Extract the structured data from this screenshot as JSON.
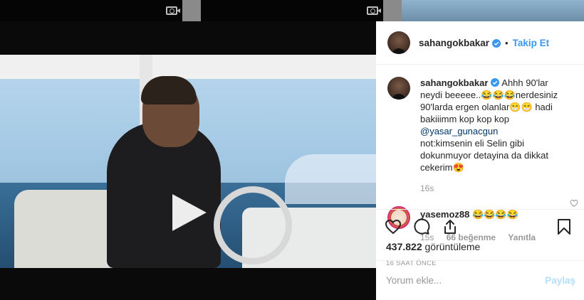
{
  "post": {
    "username": "sahangokbakar",
    "follow_label": "Takip Et",
    "caption_user": "sahangokbakar",
    "caption_text": "Ahhh 90'lar neydi beeeee..😂😂😂nerdesiniz 90'larda ergen olanlar😁😁 hadi bakiiimm kop kop kop",
    "caption_mention": "@yasar_gunacgun",
    "caption_note": "not:kimsenin eli Selin gibi dokunmuyor detayina da dikkat cekerim😍",
    "caption_time": "16s"
  },
  "comment": {
    "username": "yasemoz88",
    "text": "😂😂😂😂",
    "time": "15s",
    "likes": "66 beğenme",
    "reply_label": "Yanıtla"
  },
  "stats": {
    "views_count": "437.822",
    "views_label": "görüntüleme",
    "posted_ago": "16 SAAT ÖNCE"
  },
  "comment_box": {
    "placeholder": "Yorum ekle...",
    "post_label": "Paylaş"
  },
  "colors": {
    "link_blue": "#3897f0",
    "mention_blue": "#003569",
    "disabled_post": "#b2dffc",
    "muted": "#999999"
  },
  "icons": [
    "camera-icon",
    "play-icon",
    "verified-badge-icon",
    "heart-icon",
    "comment-icon",
    "share-icon",
    "bookmark-icon"
  ]
}
